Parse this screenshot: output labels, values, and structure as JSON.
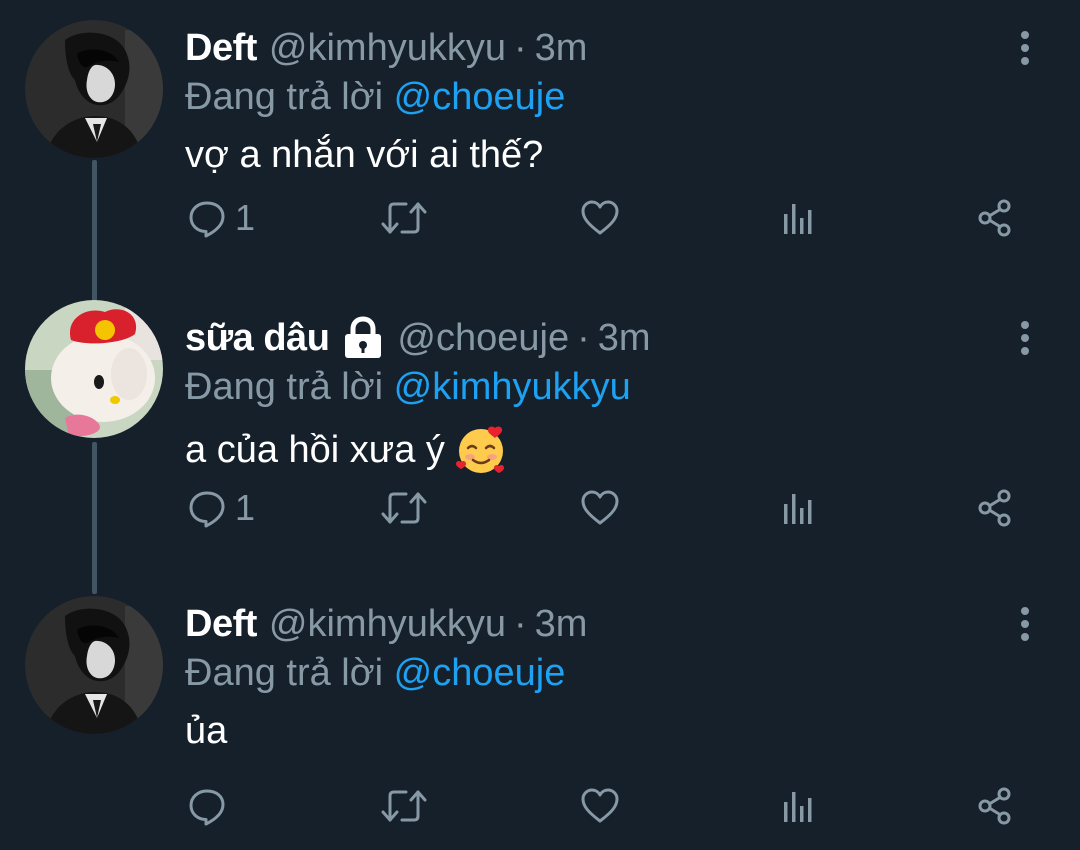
{
  "tweets": [
    {
      "display_name": "Deft",
      "handle": "@kimhyukkyu",
      "separator": "·",
      "time": "3m",
      "reply_prefix": "Đang trả lời",
      "reply_to": "@choeuje",
      "text": "vợ a nhắn với ai thế?",
      "reply_count": "1",
      "avatar": "man-portrait-avatar",
      "locked": false
    },
    {
      "display_name": "sữa dâu",
      "handle": "@choeuje",
      "separator": "·",
      "time": "3m",
      "reply_prefix": "Đang trả lời",
      "reply_to": "@kimhyukkyu",
      "text": "a của hồi xưa ý",
      "emoji": "smiling-face-with-hearts",
      "reply_count": "1",
      "avatar": "hello-kitty-avatar",
      "locked": true
    },
    {
      "display_name": "Deft",
      "handle": "@kimhyukkyu",
      "separator": "·",
      "time": "3m",
      "reply_prefix": "Đang trả lời",
      "reply_to": "@choeuje",
      "text": "ủa",
      "reply_count": "",
      "avatar": "man-portrait-avatar",
      "locked": false
    }
  ],
  "icons": {
    "reply": "reply-icon",
    "retweet": "retweet-icon",
    "like": "heart-icon",
    "analytics": "analytics-icon",
    "share": "share-icon",
    "more": "more-options-icon",
    "lock": "lock-icon"
  },
  "colors": {
    "background": "#15202b",
    "primary_text": "#ffffff",
    "secondary_text": "#8899a6",
    "mention": "#1da1f2",
    "thread_line": "#425563"
  }
}
